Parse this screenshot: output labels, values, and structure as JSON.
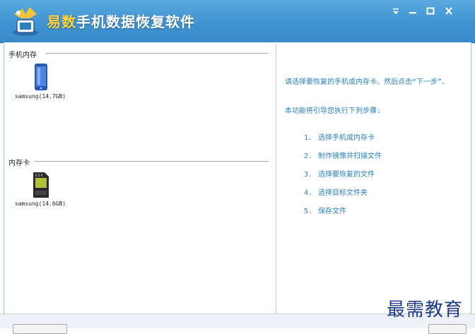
{
  "app": {
    "title_brand": "易数",
    "title_rest": "手机数据恢复软件"
  },
  "window_controls": [
    "menu-icon",
    "minimize-icon",
    "maximize-icon",
    "close-icon"
  ],
  "left": {
    "phone_memory": {
      "title": "手机内存",
      "devices": [
        {
          "label": "samsung(14.7GB)",
          "icon": "phone-icon"
        }
      ]
    },
    "memory_card": {
      "title": "内存卡",
      "devices": [
        {
          "label": "samsung(14.6GB)",
          "icon": "sd-card-icon"
        }
      ]
    }
  },
  "right": {
    "prompt": "请选择要恢复的手机或内存卡。然后点击“下一步”。",
    "intro": "本功能将引导您执行下列步骤:",
    "steps": [
      {
        "num": "1.",
        "text": "选择手机或内存卡"
      },
      {
        "num": "2.",
        "text": "制作镜像并扫描文件"
      },
      {
        "num": "3.",
        "text": "选择要恢复的文件"
      },
      {
        "num": "4.",
        "text": "选择目标文件夹"
      },
      {
        "num": "5.",
        "text": "保存文件"
      }
    ]
  },
  "watermark": "最需教育",
  "colors": {
    "titlebar": "#4a9fd9",
    "accent_text": "#2a7fbf",
    "brand_yellow": "#ffd23a"
  }
}
